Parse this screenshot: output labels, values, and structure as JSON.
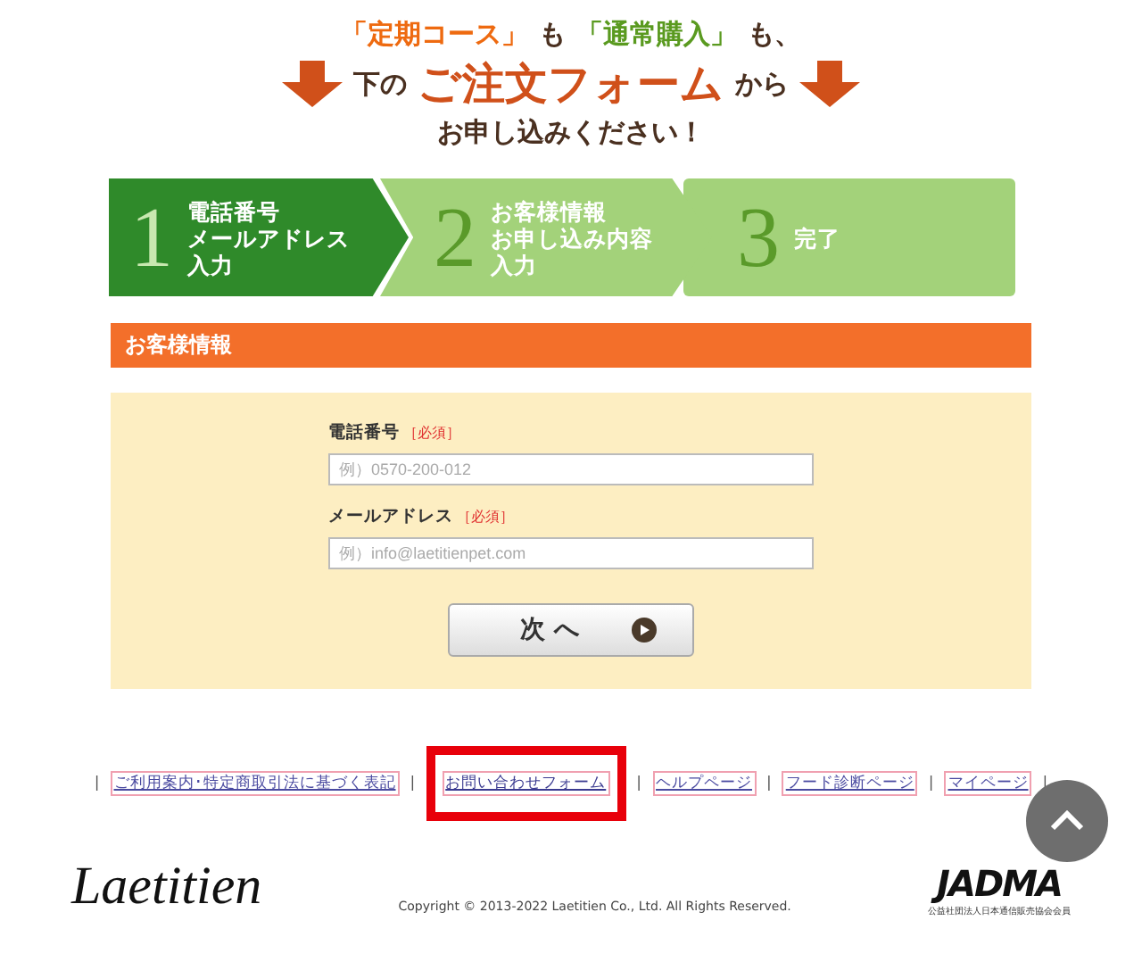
{
  "headline": {
    "line1": [
      {
        "text": "「定期コース」",
        "kind": "orange"
      },
      {
        "text": "も",
        "kind": "plain"
      },
      {
        "text": "「通常購入」",
        "kind": "green"
      },
      {
        "text": "も、",
        "kind": "plain"
      }
    ],
    "line2": [
      {
        "text": "下の",
        "kind": "plain"
      },
      {
        "text": "ご注文フォーム",
        "kind": "big"
      },
      {
        "text": "から",
        "kind": "plain"
      }
    ],
    "line3": "お申し込みください！"
  },
  "steps": [
    {
      "number": "1",
      "lines": [
        "電話番号",
        "メールアドレス",
        "入力"
      ],
      "selected": true
    },
    {
      "number": "2",
      "lines": [
        "お客様情報",
        "お申し込み内容",
        "入力"
      ],
      "selected": false
    },
    {
      "number": "3",
      "lines": [
        "完了"
      ],
      "selected": false
    }
  ],
  "section_title": "お客様情報",
  "fields": [
    {
      "label": "電話番号",
      "required": "［必須］",
      "placeholder": "例）0570-200-012"
    },
    {
      "label": "メールアドレス",
      "required": "［必須］",
      "placeholder": "例）info@laetitienpet.com"
    }
  ],
  "next_button": "次 へ",
  "footer_links": [
    {
      "label": "ご利用案内･特定商取引法に基づく表記",
      "highlighted": false
    },
    {
      "label": "お問い合わせフォーム",
      "highlighted": true
    },
    {
      "label": "ヘルプページ",
      "highlighted": false
    },
    {
      "label": "フード診断ページ",
      "highlighted": false
    },
    {
      "label": "マイページ",
      "highlighted": false
    }
  ],
  "separators": [
    "|",
    "|",
    "|",
    "|",
    "|",
    "|"
  ],
  "brand": "Laetitien",
  "copyright": "Copyright © 2013-2022 Laetitien Co., Ltd. All Rights Reserved.",
  "badge": {
    "name": "JADMA",
    "caption": "公益社団法人日本通信販売協会会員"
  }
}
